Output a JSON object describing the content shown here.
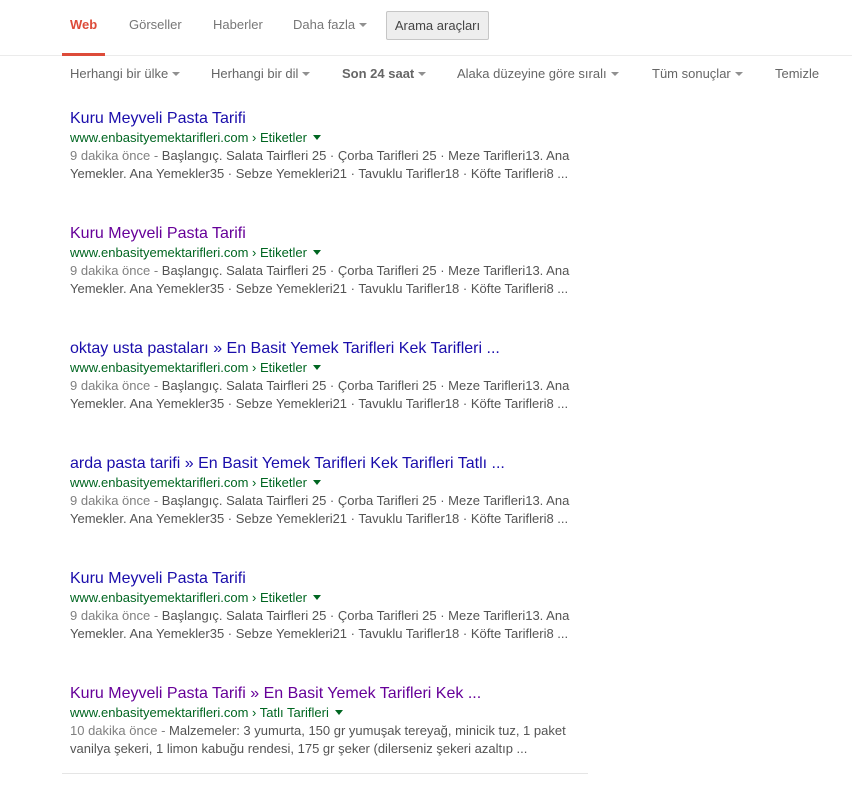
{
  "nav": {
    "tabs": [
      "Web",
      "Görseller",
      "Haberler",
      "Daha fazla"
    ],
    "tools_button": "Arama araçları"
  },
  "toolsbar": {
    "country": "Herhangi bir ülke",
    "language": "Herhangi bir dil",
    "time": "Son 24 saat",
    "sort": "Alaka düzeyine göre sıralı",
    "results": "Tüm sonuçlar",
    "clear": "Temizle"
  },
  "results": [
    {
      "title": "Kuru Meyveli Pasta Tarifi",
      "url": "www.enbasityemektarifleri.com › Etiketler",
      "time": "9 dakika önce - ",
      "snippet": "Başlangıç. Salata Tairfleri 25 · Çorba Tarifleri 25 · Meze Tarifleri13. Ana Yemekler. Ana Yemekler35 · Sebze Yemekleri21 · Tavuklu Tarifler18 · Köfte Tarifleri8 ..."
    },
    {
      "title": "Kuru Meyveli Pasta Tarifi",
      "url": "www.enbasityemektarifleri.com › Etiketler",
      "time": "9 dakika önce - ",
      "snippet": "Başlangıç. Salata Tairfleri 25 · Çorba Tarifleri 25 · Meze Tarifleri13. Ana Yemekler. Ana Yemekler35 · Sebze Yemekleri21 · Tavuklu Tarifler18 · Köfte Tarifleri8 ..."
    },
    {
      "title": "oktay usta pastaları » En Basit Yemek Tarifleri Kek Tarifleri ...",
      "url": "www.enbasityemektarifleri.com › Etiketler",
      "time": "9 dakika önce - ",
      "snippet": "Başlangıç. Salata Tairfleri 25 · Çorba Tarifleri 25 · Meze Tarifleri13. Ana Yemekler. Ana Yemekler35 · Sebze Yemekleri21 · Tavuklu Tarifler18 · Köfte Tarifleri8 ..."
    },
    {
      "title": "arda pasta tarifi » En Basit Yemek Tarifleri Kek Tarifleri Tatlı ...",
      "url": "www.enbasityemektarifleri.com › Etiketler",
      "time": "9 dakika önce - ",
      "snippet": "Başlangıç. Salata Tairfleri 25 · Çorba Tarifleri 25 · Meze Tarifleri13. Ana Yemekler. Ana Yemekler35 · Sebze Yemekleri21 · Tavuklu Tarifler18 · Köfte Tarifleri8 ..."
    },
    {
      "title": "Kuru Meyveli Pasta Tarifi",
      "url": "www.enbasityemektarifleri.com › Etiketler",
      "time": "9 dakika önce - ",
      "snippet": "Başlangıç. Salata Tairfleri 25 · Çorba Tarifleri 25 · Meze Tarifleri13. Ana Yemekler. Ana Yemekler35 · Sebze Yemekleri21 · Tavuklu Tarifler18 · Köfte Tarifleri8 ..."
    },
    {
      "title": "Kuru Meyveli Pasta Tarifi » En Basit Yemek Tarifleri Kek ...",
      "url": "www.enbasityemektarifleri.com › Tatlı Tarifleri",
      "time": "10 dakika önce - ",
      "snippet": "Malzemeler: 3 yumurta, 150 gr yumuşak tereyağ, minicik tuz, 1 paket vanilya şekeri, 1 limon kabuğu rendesi, 175 gr şeker (dilerseniz şekeri azaltıp ..."
    }
  ],
  "colors": {
    "accent": "#dd4b39",
    "link": "#1a0dab",
    "visited": "#660099",
    "url": "#006621",
    "snippet": "#545454"
  }
}
